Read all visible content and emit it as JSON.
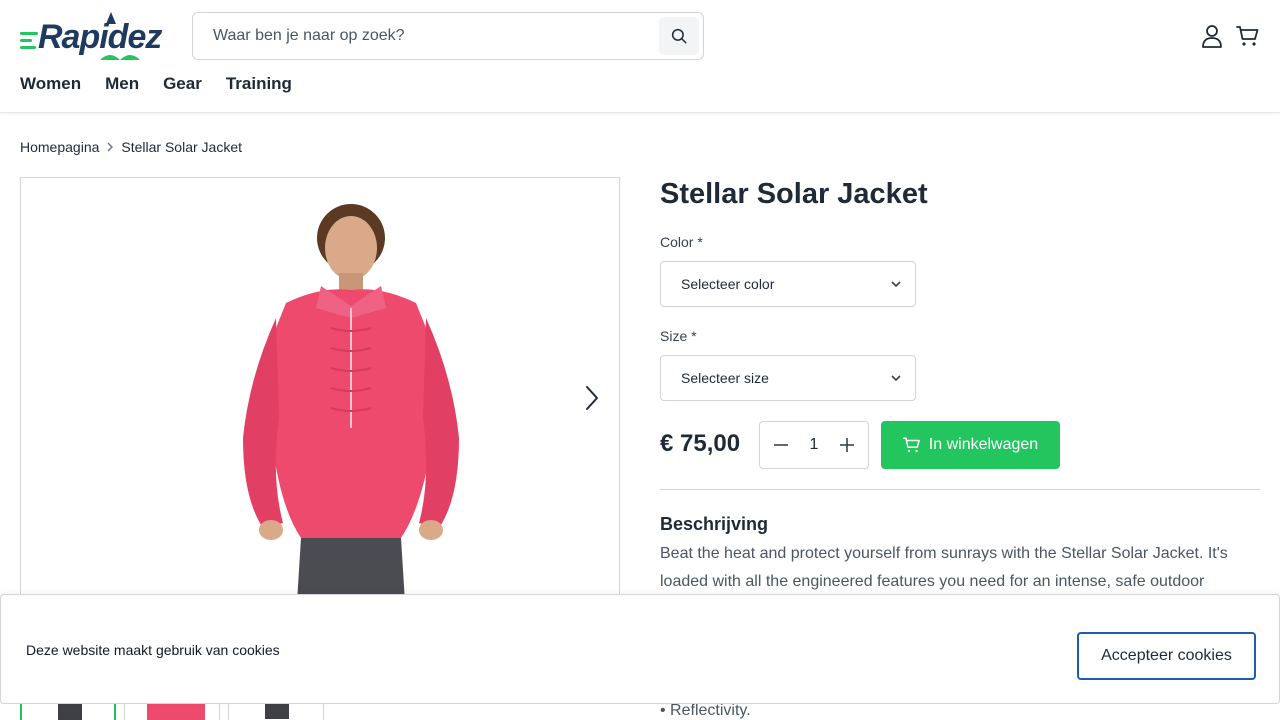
{
  "header": {
    "logo_text": "Rapidez",
    "search_placeholder": "Waar ben je naar op zoek?",
    "nav": [
      "Women",
      "Men",
      "Gear",
      "Training"
    ]
  },
  "breadcrumb": {
    "home": "Homepagina",
    "current": "Stellar Solar Jacket"
  },
  "product": {
    "title": "Stellar Solar Jacket",
    "color_label": "Color *",
    "color_select": "Selecteer color",
    "size_label": "Size *",
    "size_select": "Selecteer size",
    "price": "€ 75,00",
    "quantity": "1",
    "add_to_cart": "In winkelwagen",
    "description_title": "Beschrijving",
    "description": "Beat the heat and protect yourself from sunrays with the Stellar Solar Jacket. It's loaded with all the engineered features you need for an intense, safe outdoor",
    "bullet": "• Reflectivity."
  },
  "cookie": {
    "text": "Deze website maakt gebruik van cookies",
    "button": "Accepteer cookies"
  },
  "colors": {
    "accent": "#22c55e",
    "brand": "#1e3a5f",
    "jacket": "#ee4a6e",
    "cookie_border": "#1d5ea8"
  }
}
